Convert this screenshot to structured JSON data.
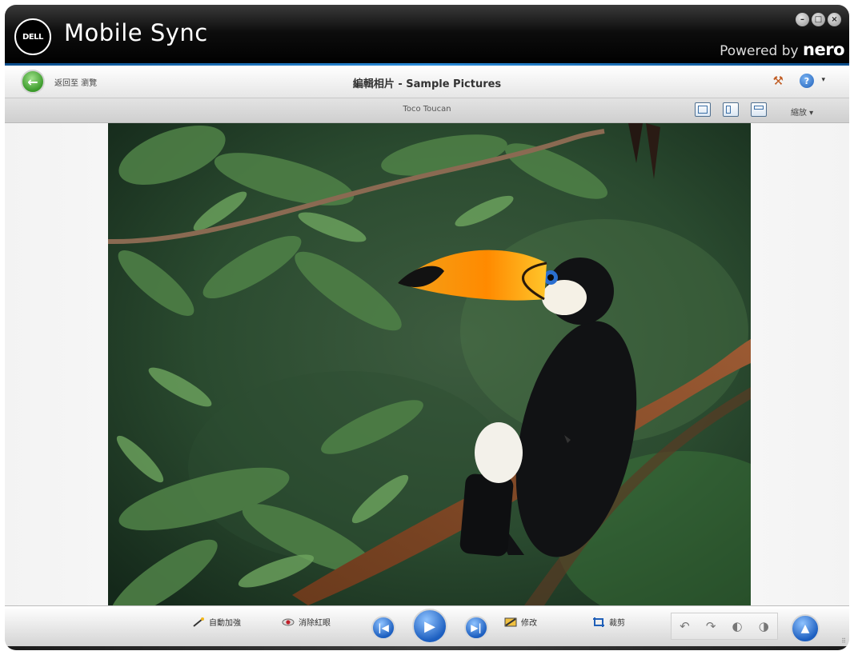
{
  "titlebar": {
    "logo_text": "DELL",
    "app_title": "Mobile Sync",
    "powered_prefix": "Powered by",
    "powered_brand": "nero",
    "controls": [
      "minimize-icon",
      "maximize-icon",
      "close-icon"
    ]
  },
  "navbar": {
    "back_label": "返回至 瀏覽",
    "page_title": "編輯相片 - Sample Pictures",
    "tools_icon": "hammer-icon",
    "help_icon": "help-icon"
  },
  "subbar": {
    "photo_name": "Toco Toucan",
    "view_icons": [
      "single-view-icon",
      "split-view-icon",
      "compare-view-icon"
    ],
    "zoom_label": "縮放 ▾"
  },
  "bottombar": {
    "auto_enhance": "自動加強",
    "red_eye": "消除紅眼",
    "modify": "修改",
    "crop": "裁剪",
    "prev_icon": "skip-back-icon",
    "play_icon": "play-icon",
    "next_icon": "skip-forward-icon",
    "rotate_icons": [
      "rotate-left-icon",
      "rotate-right-icon",
      "flip-left-icon",
      "flip-right-icon"
    ]
  },
  "colors": {
    "accent_blue": "#2b8bd8",
    "titlebar": "#0d0d0d",
    "back_green": "#3a9a2a"
  }
}
